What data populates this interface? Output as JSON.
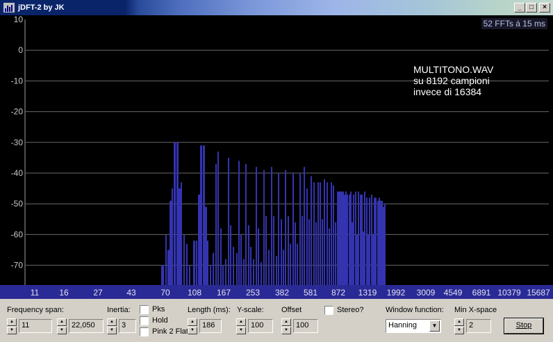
{
  "window": {
    "title": "jDFT-2 by JK",
    "minimize_glyph": "_",
    "maximize_glyph": "□",
    "close_glyph": "×",
    "app_icon": "spectrum-icon"
  },
  "plot": {
    "ffts_label": "52 FFTs á 15 ms",
    "annotation": [
      "MULTITONO.WAV",
      "su 8192 campioni",
      "invece di 16384"
    ],
    "bar_color": "#3434b0",
    "grid_color": "#6a6a6a",
    "y_ticks": [
      {
        "value": 10,
        "label": "10"
      },
      {
        "value": 0,
        "label": "0"
      },
      {
        "value": -10,
        "label": "-10"
      },
      {
        "value": -20,
        "label": "-20"
      },
      {
        "value": -30,
        "label": "-30"
      },
      {
        "value": -40,
        "label": "-40"
      },
      {
        "value": -50,
        "label": "-50"
      },
      {
        "value": -60,
        "label": "-60"
      },
      {
        "value": -70,
        "label": "-70"
      }
    ],
    "x_tick_labels": [
      "11",
      "16",
      "27",
      "43",
      "70",
      "108",
      "167",
      "253",
      "382",
      "581",
      "872",
      "1319",
      "1992",
      "3009",
      "4549",
      "6891",
      "10379",
      "15687"
    ]
  },
  "controls": {
    "frequency_span": {
      "label": "Frequency span:",
      "from": "11",
      "to": "22,050"
    },
    "inertia": {
      "label": "Inertia:",
      "value": "3"
    },
    "pks": {
      "label": "Pks",
      "checked": false
    },
    "hold": {
      "label": "Hold",
      "checked": false
    },
    "pink": {
      "label": "Pink 2 Flat",
      "checked": false
    },
    "length": {
      "label": "Length (ms):",
      "value": "186"
    },
    "y_scale": {
      "label": "Y-scale:",
      "value": "100"
    },
    "offset": {
      "label": "Offset",
      "value": "100"
    },
    "stereo": {
      "label": "Stereo?",
      "checked": false
    },
    "window_function": {
      "label": "Window function:",
      "value": "Hanning"
    },
    "min_x_space": {
      "label": "Min X-space",
      "value": "2"
    },
    "stop_button": {
      "label": "Stop"
    }
  }
}
